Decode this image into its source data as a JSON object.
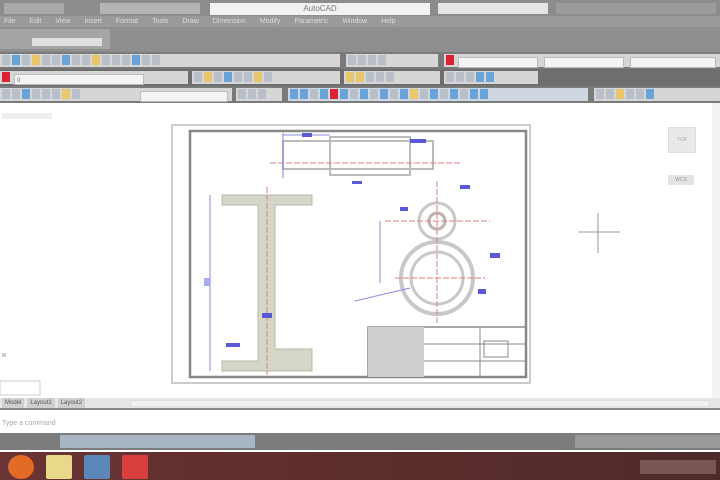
{
  "window": {
    "title": "AutoCAD"
  },
  "menu": [
    "File",
    "Edit",
    "View",
    "Insert",
    "Format",
    "Tools",
    "Draw",
    "Dimension",
    "Modify",
    "Parametric",
    "Window",
    "Help"
  ],
  "layers": {
    "current": "0"
  },
  "viewcube": {
    "face": "TOP",
    "wcs": "WCS"
  },
  "tabs": [
    "Model",
    "Layout1",
    "Layout2"
  ],
  "command": {
    "placeholder": "Type a command"
  },
  "colors": {
    "dimension": "#5a5ad8",
    "centerline": "#d88080",
    "part": "#c8c8b8",
    "taskbar": "#5a2c2c"
  }
}
